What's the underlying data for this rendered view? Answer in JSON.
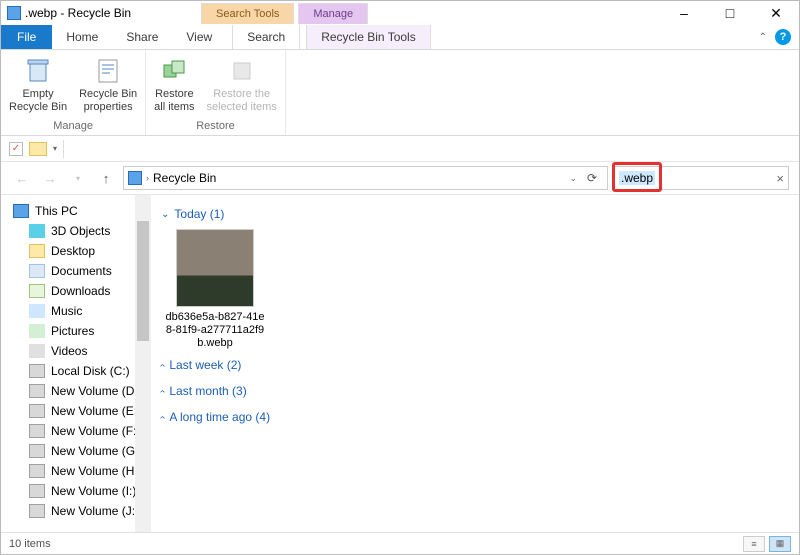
{
  "title": ".webp - Recycle Bin",
  "context_tabs": {
    "search": "Search Tools",
    "manage": "Manage"
  },
  "ribbon_tabs": {
    "file": "File",
    "home": "Home",
    "share": "Share",
    "view": "View",
    "search": "Search",
    "recycle": "Recycle Bin Tools"
  },
  "ribbon": {
    "empty": "Empty\nRecycle Bin",
    "props": "Recycle Bin\nproperties",
    "restore_all": "Restore\nall items",
    "restore_sel": "Restore the\nselected items",
    "group_manage": "Manage",
    "group_restore": "Restore"
  },
  "addr": {
    "location": "Recycle Bin"
  },
  "search": {
    "value": ".webp"
  },
  "nav": {
    "this_pc": "This PC",
    "items": [
      "3D Objects",
      "Desktop",
      "Documents",
      "Downloads",
      "Music",
      "Pictures",
      "Videos",
      "Local Disk (C:)",
      "New Volume (D:)",
      "New Volume (E:)",
      "New Volume (F:)",
      "New Volume (G:)",
      "New Volume (H:)",
      "New Volume (I:)",
      "New Volume (J:)"
    ]
  },
  "groups": {
    "today": "Today (1)",
    "last_week": "Last week (2)",
    "last_month": "Last month (3)",
    "long_ago": "A long time ago (4)"
  },
  "file_item": "db636e5a-b827-41e8-81f9-a277711a2f9b.webp",
  "status": "10 items"
}
